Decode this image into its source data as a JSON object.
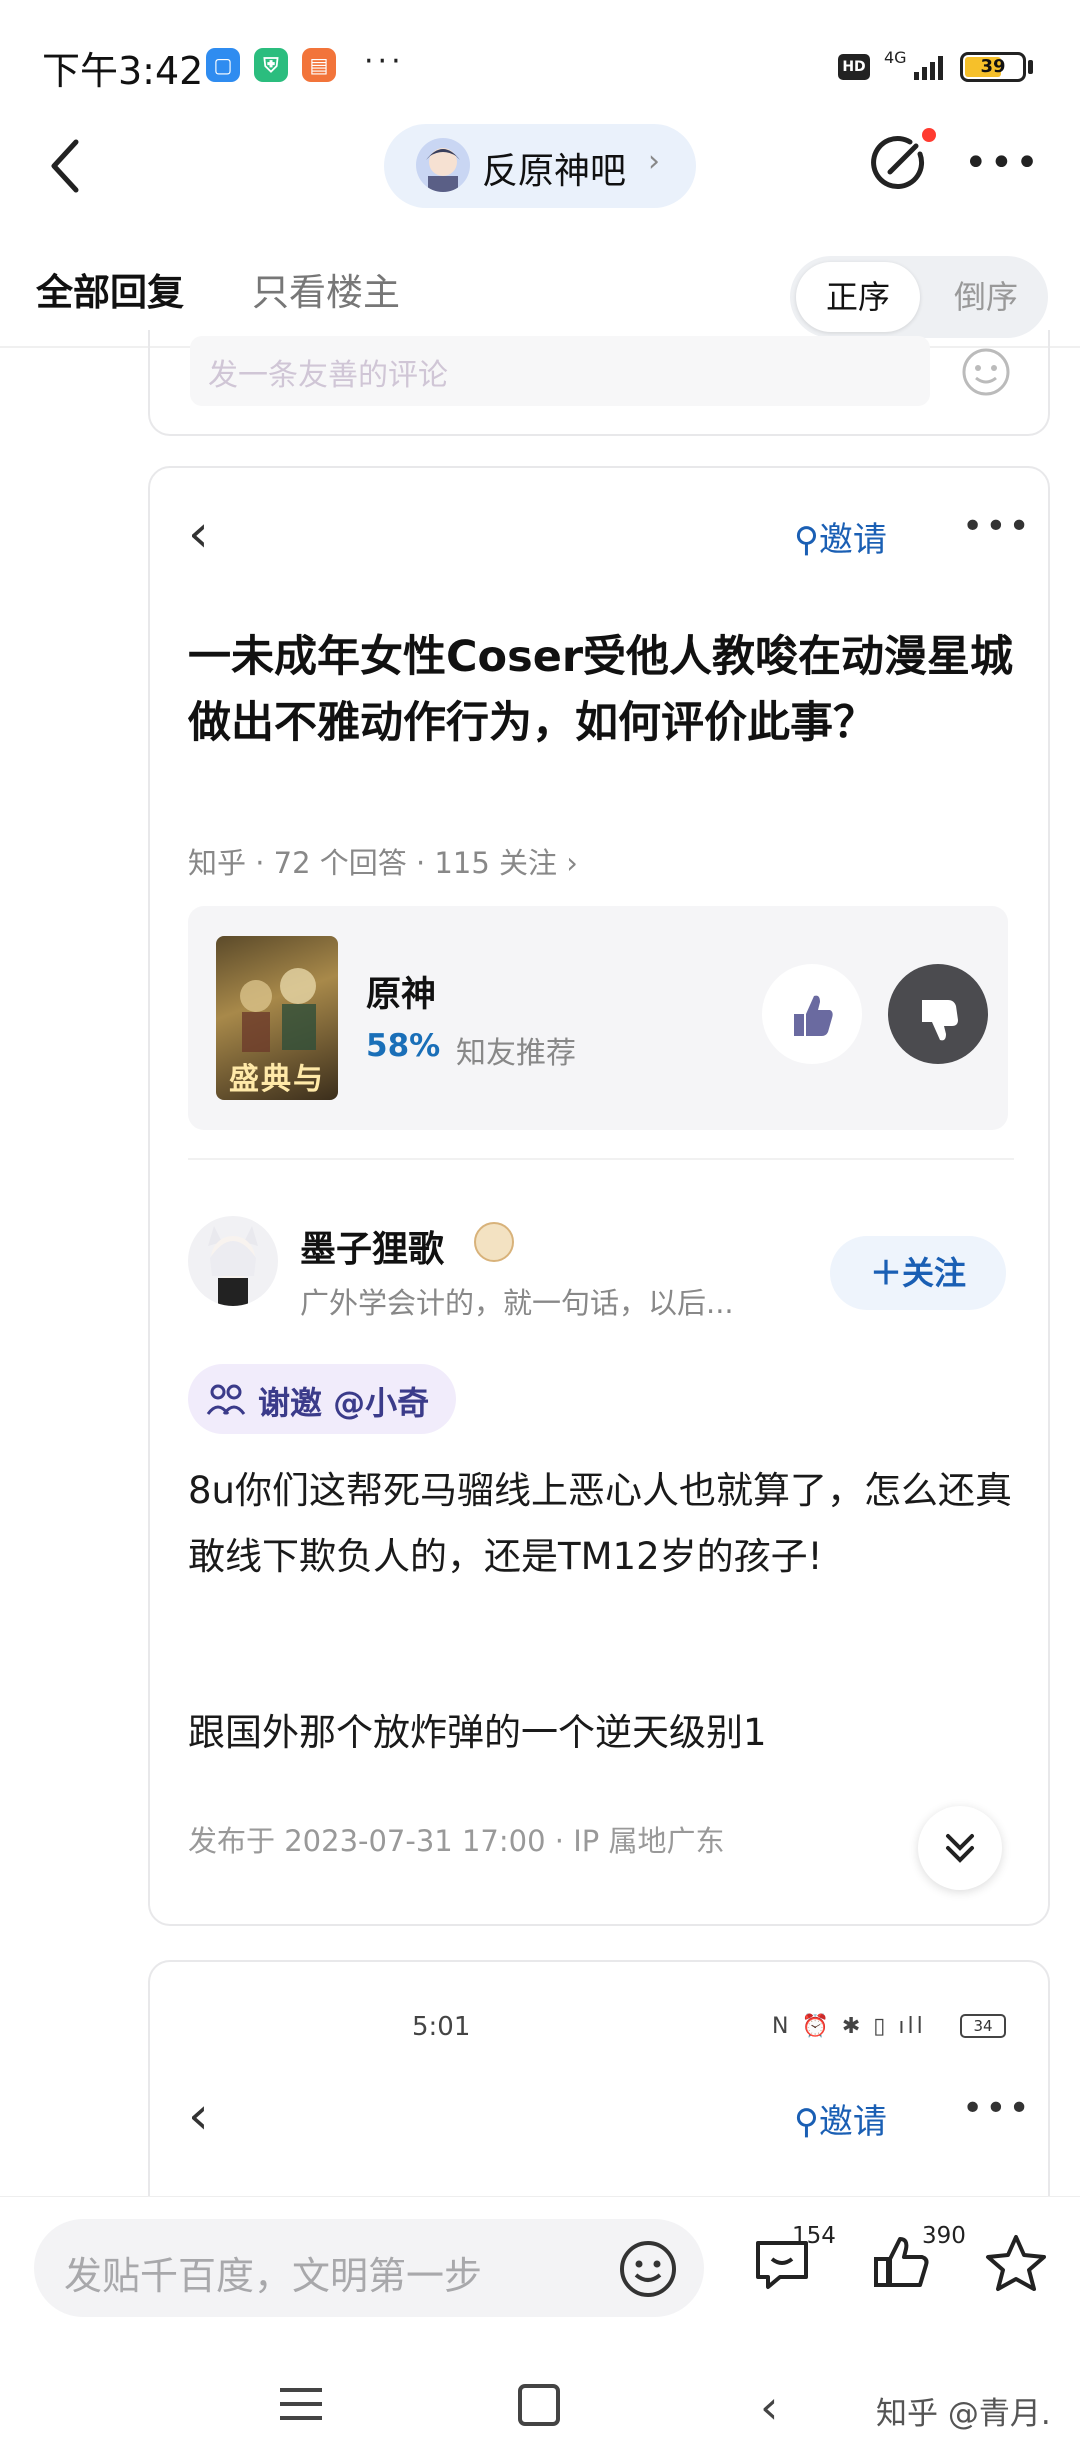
{
  "status_bar": {
    "time": "下午3:42",
    "more": "···",
    "hd": "HD",
    "network": "4G",
    "battery": "39"
  },
  "header": {
    "forum_name": "反原神吧",
    "chevron": "›"
  },
  "tabs": {
    "all_replies": "全部回复",
    "op_only": "只看楼主",
    "order_asc": "正序",
    "order_desc": "倒序"
  },
  "comment_box": {
    "placeholder": "发一条友善的评论"
  },
  "zhihu_card": {
    "invite": "邀请",
    "question_title": "一未成年女性Coser受他人教唆在动漫星城做出不雅动作行为，如何评价此事？",
    "question_meta": "知乎 · 72 个回答 · 115 关注 ›",
    "recommend": {
      "cover_text": "盛典与慧",
      "game_name": "原神",
      "percent": "58%",
      "label": "知友推荐"
    },
    "answer": {
      "author_name": "墨子狸歌",
      "author_bio": "广外学会计的，就一句话，以后...",
      "follow_label": "＋关注",
      "thanks_tag": "谢邀 @小奇",
      "paragraph1": "8u你们这帮死马骝线上恶心人也就算了，怎么还真敢线下欺负人的，还是TM12岁的孩子!",
      "paragraph2": "跟国外那个放炸弹的一个逆天级别1",
      "date": "发布于 2023-07-31 17:00 · IP 属地广东"
    }
  },
  "zhihu_card_2": {
    "time": "5:01",
    "status_icons": "N ⏰ ✱ ▯ ıll",
    "battery": "34",
    "invite": "邀请"
  },
  "bottom_bar": {
    "input_placeholder": "发贴千百度，文明第一步",
    "comment_count": "154",
    "like_count": "390"
  },
  "watermark": "知乎 @青月.",
  "colors": {
    "accent_blue": "#1a5fb4",
    "pct_blue": "#1a6fb8",
    "forum_pill": "#eaf1fb",
    "red_dot": "#ff3b30"
  }
}
